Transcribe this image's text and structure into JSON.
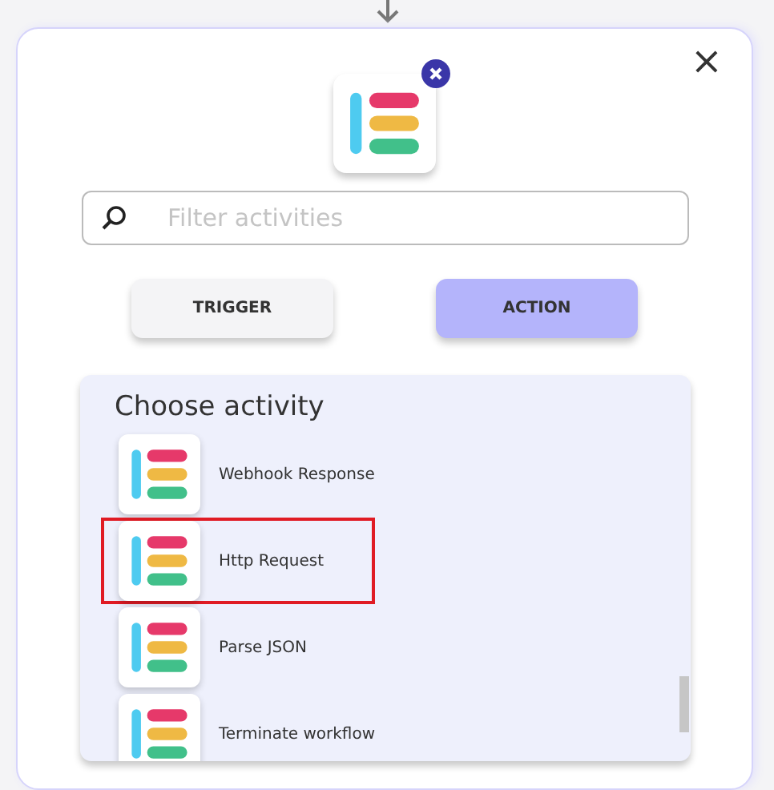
{
  "dialog": {
    "close_label": "×"
  },
  "search": {
    "placeholder": "Filter activities"
  },
  "tabs": [
    {
      "label": "TRIGGER",
      "selected": false
    },
    {
      "label": "ACTION",
      "selected": true
    }
  ],
  "panel": {
    "title": "Choose activity",
    "items": [
      {
        "label": "Webhook Response",
        "highlighted": false
      },
      {
        "label": "Http Request",
        "highlighted": true
      },
      {
        "label": "Parse JSON",
        "highlighted": false
      },
      {
        "label": "Terminate workflow",
        "highlighted": false
      }
    ]
  }
}
